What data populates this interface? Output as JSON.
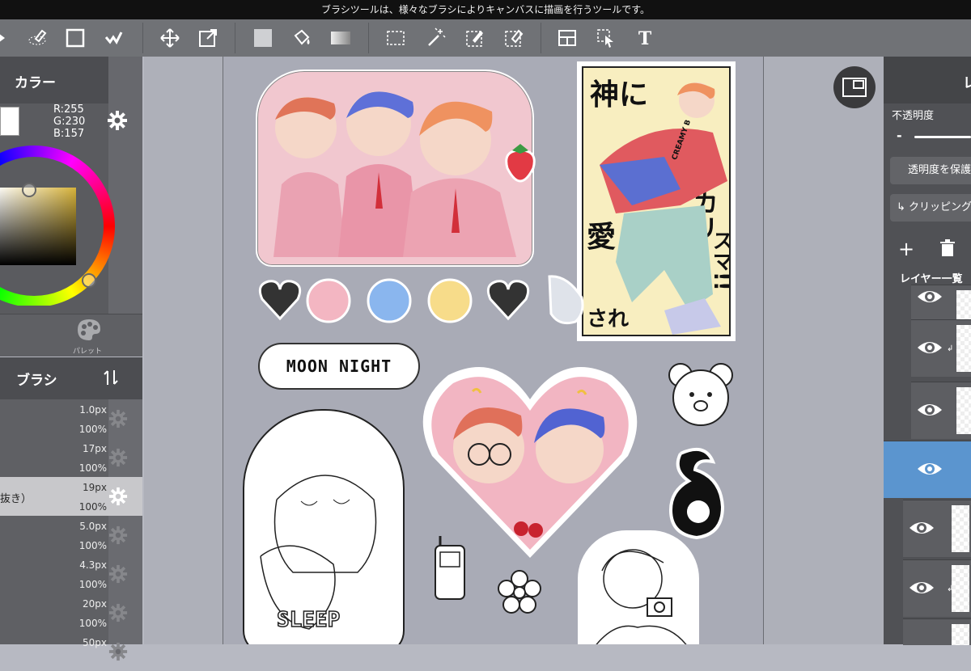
{
  "tooltip": "ブラシツールは、様々なブラシによりキャンバスに描画を行うツールです。",
  "toolbar": {
    "tools": [
      "brush-icon",
      "eraser-icon",
      "rectangle-icon",
      "fill-stroke-icon",
      "move-icon",
      "transform-icon",
      "fill-color-icon",
      "bucket-icon",
      "gradient-icon",
      "select-rect-icon",
      "magic-wand-icon",
      "select-pen-icon",
      "select-eraser-icon",
      "frame-divider-icon",
      "operation-icon",
      "text-icon"
    ]
  },
  "color_panel": {
    "title": "カラー",
    "r": "R:255",
    "g": "G:230",
    "b": "B:157",
    "palette_label": "パレット"
  },
  "brush_panel": {
    "title": "ブラシ",
    "rows": [
      {
        "name": "",
        "size": "1.0px",
        "opacity": "100%"
      },
      {
        "name": "",
        "size": "17px",
        "opacity": "100%"
      },
      {
        "name": "抜き）",
        "size": "19px",
        "opacity": "100%",
        "selected": true
      },
      {
        "name": "",
        "size": "5.0px",
        "opacity": "100%"
      },
      {
        "name": "",
        "size": "4.3px",
        "opacity": "100%"
      },
      {
        "name": "",
        "size": "20px",
        "opacity": "100%"
      },
      {
        "name": "",
        "size": "50px",
        "opacity": ""
      }
    ]
  },
  "layer_panel": {
    "title": "レ",
    "opacity_label": "不透明度",
    "opacity_minus": "-",
    "protect_button": "透明度を保護",
    "clipping_button": "クリッピング",
    "add_label": "+",
    "list_label": "レイヤー一覧"
  },
  "canvas": {
    "moon_night": "MOON NIGHT",
    "sleep": "SLEEP",
    "poster_text_1": "神に",
    "poster_text_2": "カリ",
    "poster_text_3": "スマ!!",
    "poster_text_4": "愛",
    "poster_text_5": "され",
    "jacket_text": "CREAMY B"
  }
}
